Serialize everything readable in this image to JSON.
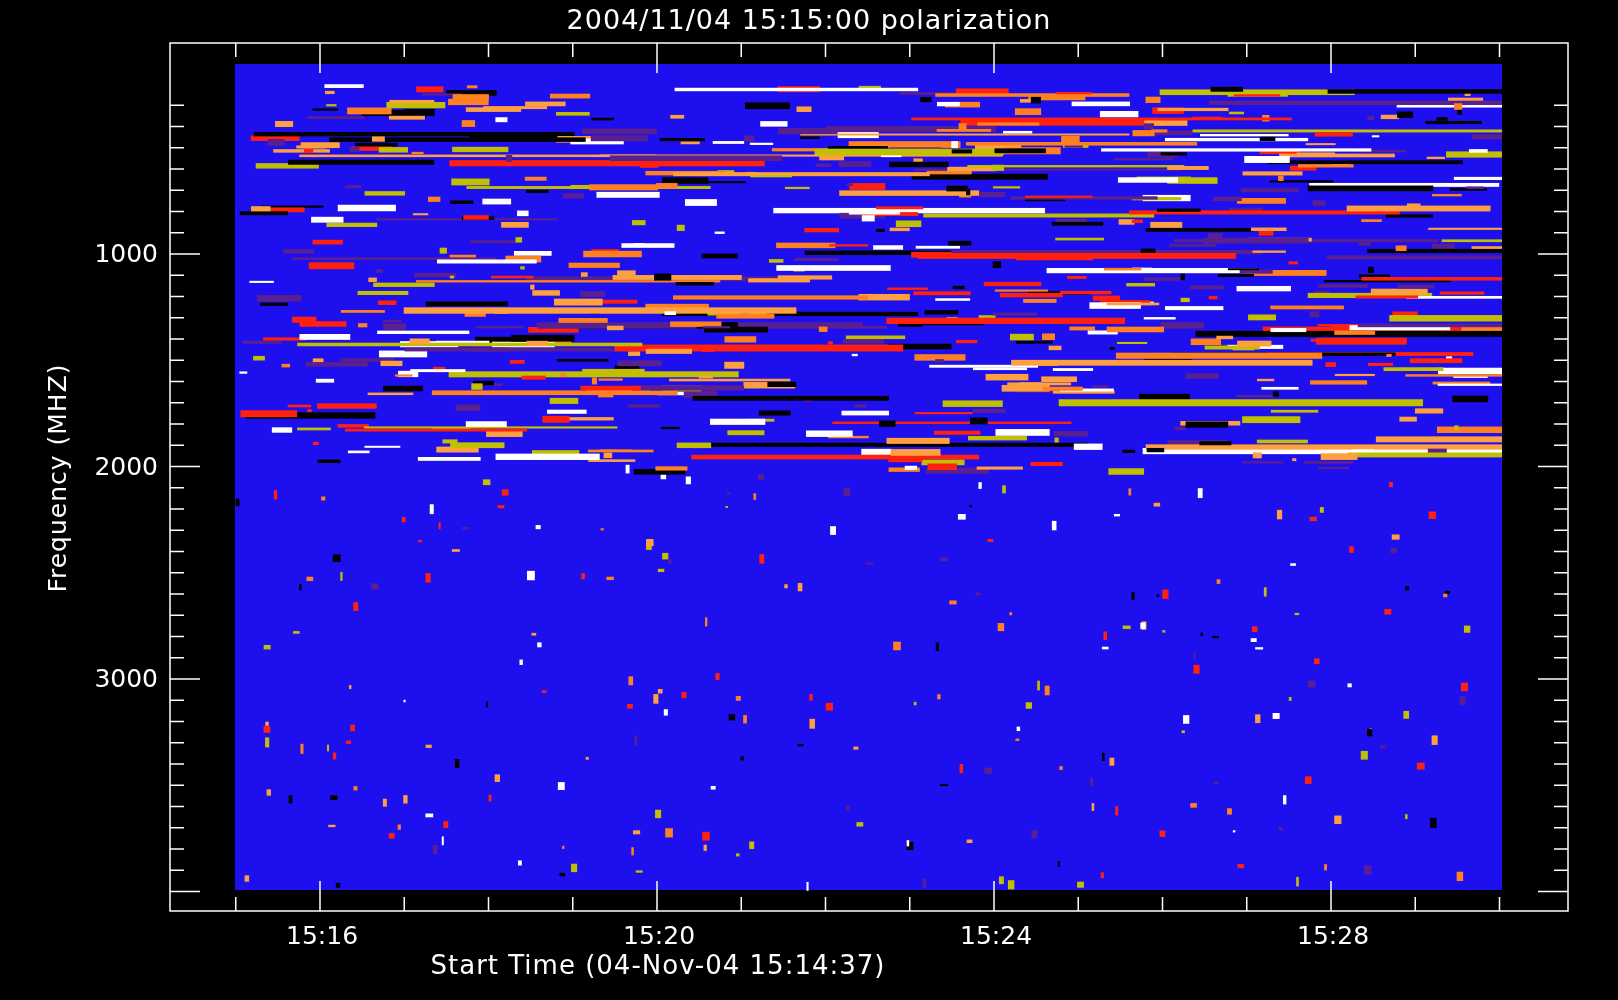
{
  "title": "2004/11/04 15:15:00 polarization",
  "y_axis": {
    "label": "Frequency (MHZ)",
    "ticks": [
      "1000",
      "2000",
      "3000"
    ]
  },
  "x_axis": {
    "label": "Start Time (04-Nov-04 15:14:37)",
    "ticks": [
      "15:16",
      "15:20",
      "15:24",
      "15:28"
    ]
  }
}
